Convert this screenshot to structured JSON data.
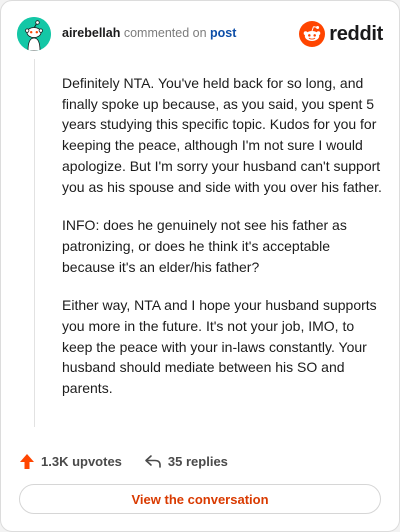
{
  "header": {
    "username": "airebellah",
    "commented_on": "commented on",
    "post_link": "post",
    "logo_text": "reddit"
  },
  "comment": {
    "paragraphs": [
      "Definitely NTA. You've held back for so long, and finally spoke up because, as you said, you spent 5 years studying this specific topic. Kudos for you for keeping the peace, although I'm not sure I would apologize. But I'm sorry your husband can't support you as his spouse and side with you over his father.",
      "INFO: does he genuinely not see his father as patronizing, or does he think it's acceptable because it's an elder/his father?",
      "Either way, NTA and I hope your husband supports you more in the future. It's not your job, IMO, to keep the peace with your in-laws constantly. Your husband should mediate between his SO and parents."
    ]
  },
  "actions": {
    "upvotes": "1.3K upvotes",
    "replies": "35 replies"
  },
  "cta": {
    "label": "View the conversation"
  },
  "colors": {
    "avatar_bg": "#14c7a6",
    "brand_orange": "#ff4500",
    "cta_text": "#d93a00",
    "post_link": "#0d4ea8"
  },
  "icons": {
    "avatar": "snoo-avatar-icon",
    "logo": "reddit-snoo-icon",
    "upvote": "upvote-arrow-icon",
    "reply": "reply-arrow-icon"
  }
}
